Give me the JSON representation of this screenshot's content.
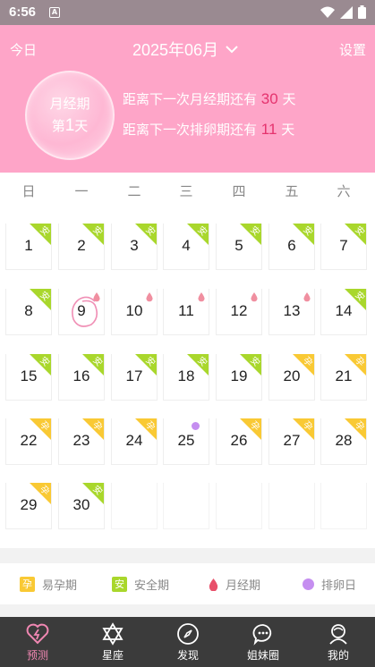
{
  "status": {
    "time": "6:56",
    "notif_icon": "A"
  },
  "header": {
    "today_label": "今日",
    "month_label": "2025年06月",
    "settings_label": "设置",
    "bubble_line1": "月经期",
    "bubble_prefix": "第",
    "bubble_day": "1",
    "bubble_suffix": "天",
    "info1_prefix": "距离下一次月经期还有",
    "info1_value": "30",
    "info1_suffix": "天",
    "info2_prefix": "距离下一次排卵期还有",
    "info2_value": "11",
    "info2_suffix": "天"
  },
  "weekdays": [
    "日",
    "一",
    "二",
    "三",
    "四",
    "五",
    "六"
  ],
  "tag_labels": {
    "safe": "安",
    "fertile": "孕"
  },
  "days": [
    {
      "d": "1",
      "tag": "safe"
    },
    {
      "d": "2",
      "tag": "safe"
    },
    {
      "d": "3",
      "tag": "safe"
    },
    {
      "d": "4",
      "tag": "safe"
    },
    {
      "d": "5",
      "tag": "safe"
    },
    {
      "d": "6",
      "tag": "safe"
    },
    {
      "d": "7",
      "tag": "safe"
    },
    {
      "d": "8",
      "tag": "safe"
    },
    {
      "d": "9",
      "tag": "period",
      "today": true
    },
    {
      "d": "10",
      "tag": "period"
    },
    {
      "d": "11",
      "tag": "period"
    },
    {
      "d": "12",
      "tag": "period"
    },
    {
      "d": "13",
      "tag": "period"
    },
    {
      "d": "14",
      "tag": "safe"
    },
    {
      "d": "15",
      "tag": "safe"
    },
    {
      "d": "16",
      "tag": "safe"
    },
    {
      "d": "17",
      "tag": "safe"
    },
    {
      "d": "18",
      "tag": "safe"
    },
    {
      "d": "19",
      "tag": "safe"
    },
    {
      "d": "20",
      "tag": "fertile"
    },
    {
      "d": "21",
      "tag": "fertile"
    },
    {
      "d": "22",
      "tag": "fertile"
    },
    {
      "d": "23",
      "tag": "fertile"
    },
    {
      "d": "24",
      "tag": "fertile"
    },
    {
      "d": "25",
      "tag": "ovulation"
    },
    {
      "d": "26",
      "tag": "fertile"
    },
    {
      "d": "27",
      "tag": "fertile"
    },
    {
      "d": "28",
      "tag": "fertile"
    },
    {
      "d": "29",
      "tag": "fertile"
    },
    {
      "d": "30",
      "tag": "safe"
    }
  ],
  "legend": {
    "fertile": "易孕期",
    "safe": "安全期",
    "period": "月经期",
    "ovulation": "排卵日"
  },
  "tabs": [
    {
      "label": "预测",
      "icon": "heart-icon",
      "active": true
    },
    {
      "label": "星座",
      "icon": "star-of-david-icon"
    },
    {
      "label": "发现",
      "icon": "compass-icon"
    },
    {
      "label": "姐妹圈",
      "icon": "chat-bubble-icon"
    },
    {
      "label": "我的",
      "icon": "user-icon"
    }
  ],
  "colors": {
    "header_bg": "#fea5c8",
    "safe": "#a9d72c",
    "fertile": "#f9c934",
    "period_drop": "#f08fa0",
    "ovulation": "#c58ef0",
    "highlight_number": "#e5336e",
    "tab_active": "#f087b2"
  }
}
